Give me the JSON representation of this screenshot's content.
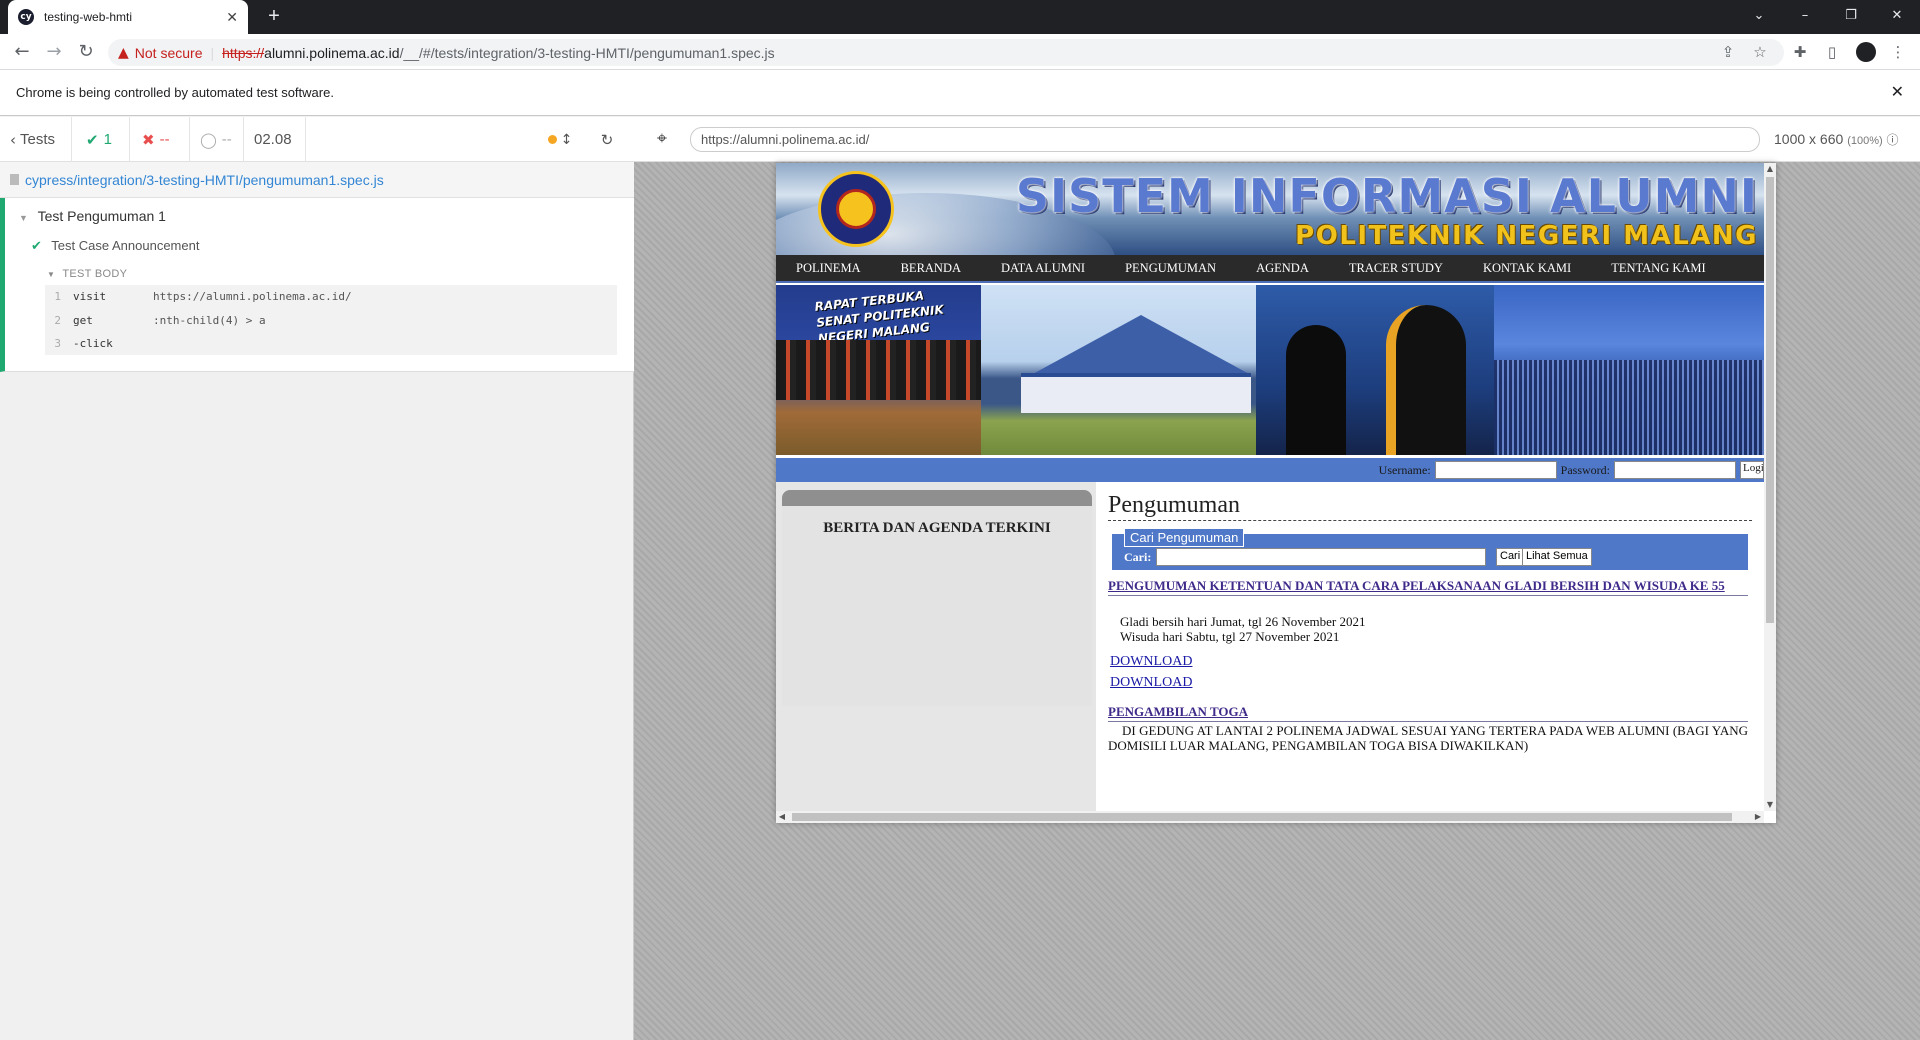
{
  "browser": {
    "tab_title": "testing-web-hmti",
    "tab_favicon": "cy",
    "security_label": "Not secure",
    "url_scheme": "https://",
    "url_host": "alumni.polinema.ac.id",
    "url_path": "/__/#/tests/integration/3-testing-HMTI/pengumuman1.spec.js",
    "infobar_text": "Chrome is being controlled by automated test software."
  },
  "reporter": {
    "tests_label": "Tests",
    "passed": "1",
    "failed": "--",
    "pending": "--",
    "duration": "02.08",
    "spec_path": "cypress/integration/3-testing-HMTI/pengumuman1.spec.js",
    "suite_title": "Test Pengumuman 1",
    "test_title": "Test Case Announcement",
    "test_body_label": "TEST BODY",
    "commands": [
      {
        "num": "1",
        "name": "visit",
        "arg": "https://alumni.polinema.ac.id/"
      },
      {
        "num": "2",
        "name": "get",
        "arg": ":nth-child(4) > a"
      },
      {
        "num": "3",
        "name": "-click",
        "arg": ""
      }
    ]
  },
  "aut": {
    "url": "https://alumni.polinema.ac.id/",
    "viewport": "1000 x 660",
    "scale": "(100%)"
  },
  "site": {
    "title": "SISTEM INFORMASI ALUMNI",
    "subtitle": "POLITEKNIK NEGERI MALANG",
    "nav": [
      "POLINEMA",
      "BERANDA",
      "DATA ALUMNI",
      "PENGUMUMAN",
      "AGENDA",
      "TRACER STUDY",
      "KONTAK KAMI",
      "TENTANG KAMI"
    ],
    "photo_banner_text": "RAPAT TERBUKA SENAT POLITEKNIK NEGERI MALANG",
    "login": {
      "username_label": "Username:",
      "password_label": "Password:",
      "login_button": "Login"
    },
    "sidebar_heading": "BERITA DAN AGENDA TERKINI",
    "page_title": "Pengumuman",
    "search": {
      "legend": "Cari Pengumuman",
      "label": "Cari:",
      "search_button": "Cari",
      "all_button": "Lihat Semua"
    },
    "announcements": [
      {
        "title": "PENGUMUMAN KETENTUAN DAN TATA CARA PELAKSANAAN GLADI BERSIH DAN WISUDA KE 55",
        "lines": [
          "Gladi bersih hari Jumat, tgl 26 November 2021",
          "Wisuda hari Sabtu, tgl 27 November 2021"
        ],
        "downloads": [
          "DOWNLOAD",
          "DOWNLOAD"
        ]
      },
      {
        "title": "PENGAMBILAN TOGA",
        "text": "DI GEDUNG AT LANTAI 2 POLINEMA JADWAL SESUAI YANG TERTERA PADA WEB ALUMNI (BAGI YANG DOMISILI LUAR MALANG, PENGAMBILAN TOGA BISA DIWAKILKAN)"
      }
    ]
  },
  "colors": {
    "pass_green": "#1fa971",
    "fail_red": "#e94f4f",
    "nav_bg": "#2a2a2a",
    "site_blue": "#4f78c8"
  }
}
